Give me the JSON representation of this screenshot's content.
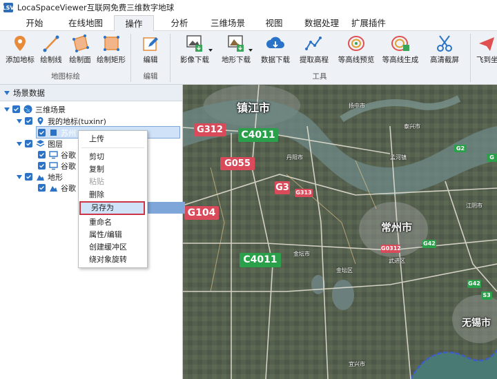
{
  "titlebar": {
    "icon_text": "LSV",
    "title": "LocaSpaceViewer互联网免费三维数字地球"
  },
  "menu": {
    "tabs": [
      "开始",
      "在线地图",
      "操作",
      "分析",
      "三维场景",
      "视图",
      "数据处理",
      "扩展插件"
    ],
    "active": "操作"
  },
  "ribbon": {
    "groups": [
      {
        "label": "地图标绘",
        "buttons": [
          "添加地标",
          "绘制线",
          "绘制面",
          "绘制矩形"
        ]
      },
      {
        "label": "编辑",
        "buttons": [
          "编辑"
        ]
      },
      {
        "label": "工具",
        "buttons": [
          "影像下载",
          "地形下载",
          "数据下载",
          "提取高程",
          "等高线预览",
          "等高线生成",
          "高清截屏"
        ]
      },
      {
        "label": "",
        "buttons": [
          "飞到坐"
        ]
      }
    ]
  },
  "panel": {
    "title": "场景数据",
    "tree": {
      "scene": "三维场景",
      "my_placemarks": "我的地标(tuxinr)",
      "placemark_item": "苏州",
      "layers": "图层",
      "layer_item_1": "谷歌",
      "layer_item_2": "谷歌",
      "terrain": "地形",
      "terrain_item": "谷歌"
    }
  },
  "context_menu": {
    "upload": "上传",
    "cut": "剪切",
    "copy": "复制",
    "paste": "粘贴",
    "delete": "删除",
    "save_as": "另存为",
    "rename": "重命名",
    "properties": "属性/编辑",
    "buffer": "创建缓冲区",
    "rotate": "绕对象旋转"
  },
  "map": {
    "cities": {
      "zhenjiang": "镇江市",
      "changzhou": "常州市",
      "wuxi": "无锡市"
    },
    "roads": {
      "g312": "G312",
      "c4011_top": "C4011",
      "g055": "G055",
      "g3": "G3",
      "g104": "G104",
      "c4011_bottom": "C4011",
      "g313": "G313",
      "g2": "G2",
      "g0312": "G0312",
      "g42": "G42",
      "g42b": "G42",
      "s3": "S3",
      "g": "G"
    },
    "towns": {
      "t1": "扬中市",
      "t2": "泰兴市",
      "t3": "金坛市",
      "t4": "江阴市",
      "t5": "宜兴市",
      "t6": "孟河镇",
      "t7": "丹阳市",
      "t8": "金坛区",
      "t9": "武进区"
    }
  }
}
